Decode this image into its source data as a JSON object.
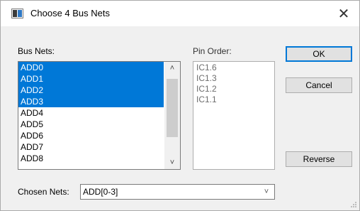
{
  "window": {
    "title": "Choose 4 Bus Nets",
    "close_glyph": "✕"
  },
  "bus_nets": {
    "label": "Bus Nets:",
    "items": [
      {
        "label": "ADD0",
        "selected": true
      },
      {
        "label": "ADD1",
        "selected": true
      },
      {
        "label": "ADD2",
        "selected": true
      },
      {
        "label": "ADD3",
        "selected": true
      },
      {
        "label": "ADD4",
        "selected": false
      },
      {
        "label": "ADD5",
        "selected": false
      },
      {
        "label": "ADD6",
        "selected": false
      },
      {
        "label": "ADD7",
        "selected": false
      },
      {
        "label": "ADD8",
        "selected": false
      }
    ],
    "scroll_up_glyph": "˄",
    "scroll_down_glyph": "˅"
  },
  "pin_order": {
    "label": "Pin Order:",
    "items": [
      "IC1.6",
      "IC1.3",
      "IC1.2",
      "IC1.1"
    ]
  },
  "buttons": {
    "ok": "OK",
    "cancel": "Cancel",
    "reverse": "Reverse"
  },
  "chosen_nets": {
    "label": "Chosen Nets:",
    "value": "ADD[0-3]",
    "arrow_glyph": "˅"
  },
  "colors": {
    "selection": "#0078d7",
    "disabled_text": "#6d6d6d"
  }
}
